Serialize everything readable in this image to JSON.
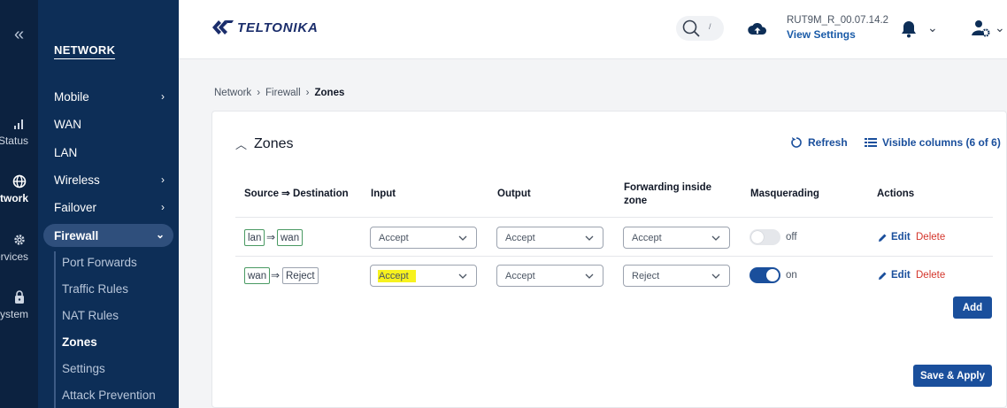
{
  "rail": {
    "items": [
      {
        "label": "Status",
        "icon": "signal-bars-icon"
      },
      {
        "label": "Network",
        "icon": "globe-icon"
      },
      {
        "label": "Services",
        "icon": "gear-icon"
      },
      {
        "label": "System",
        "icon": "lock-icon"
      }
    ]
  },
  "nav": {
    "title": "NETWORK",
    "items": [
      {
        "label": "Mobile"
      },
      {
        "label": "WAN"
      },
      {
        "label": "LAN"
      },
      {
        "label": "Wireless"
      },
      {
        "label": "Failover"
      },
      {
        "label": "Firewall"
      }
    ],
    "sub_items": [
      {
        "label": "Port Forwards"
      },
      {
        "label": "Traffic Rules"
      },
      {
        "label": "NAT Rules"
      },
      {
        "label": "Zones"
      },
      {
        "label": "Settings"
      },
      {
        "label": "Attack Prevention"
      }
    ]
  },
  "header": {
    "brand": "TELTONIKA",
    "search_shortcut": "/",
    "device_name": "RUT9M_R_00.07.14.2",
    "view_settings": "View Settings"
  },
  "breadcrumb": [
    "Network",
    "Firewall",
    "Zones"
  ],
  "card": {
    "title": "Zones",
    "refresh": "Refresh",
    "visible_columns": "Visible columns (6 of 6)",
    "columns": [
      "Source ⇒ Destination",
      "Input",
      "Output",
      "Forwarding inside zone",
      "Masquerading",
      "Actions"
    ],
    "rows": [
      {
        "source": "lan",
        "destination": "wan",
        "input": "Accept",
        "output": "Accept",
        "forward": "Accept",
        "masq": "off",
        "edit": "Edit",
        "delete": "Delete"
      },
      {
        "source": "wan",
        "destination": "Reject",
        "input": "Accept",
        "output": "Accept",
        "forward": "Reject",
        "masq": "on",
        "edit": "Edit",
        "delete": "Delete"
      }
    ],
    "add": "Add",
    "save_apply": "Save & Apply"
  },
  "colors": {
    "accent": "#1a4f9c",
    "sidebar": "#0d2e57",
    "rail": "#0c2240",
    "danger": "#d4352b",
    "highlight": "#f7f21e"
  }
}
